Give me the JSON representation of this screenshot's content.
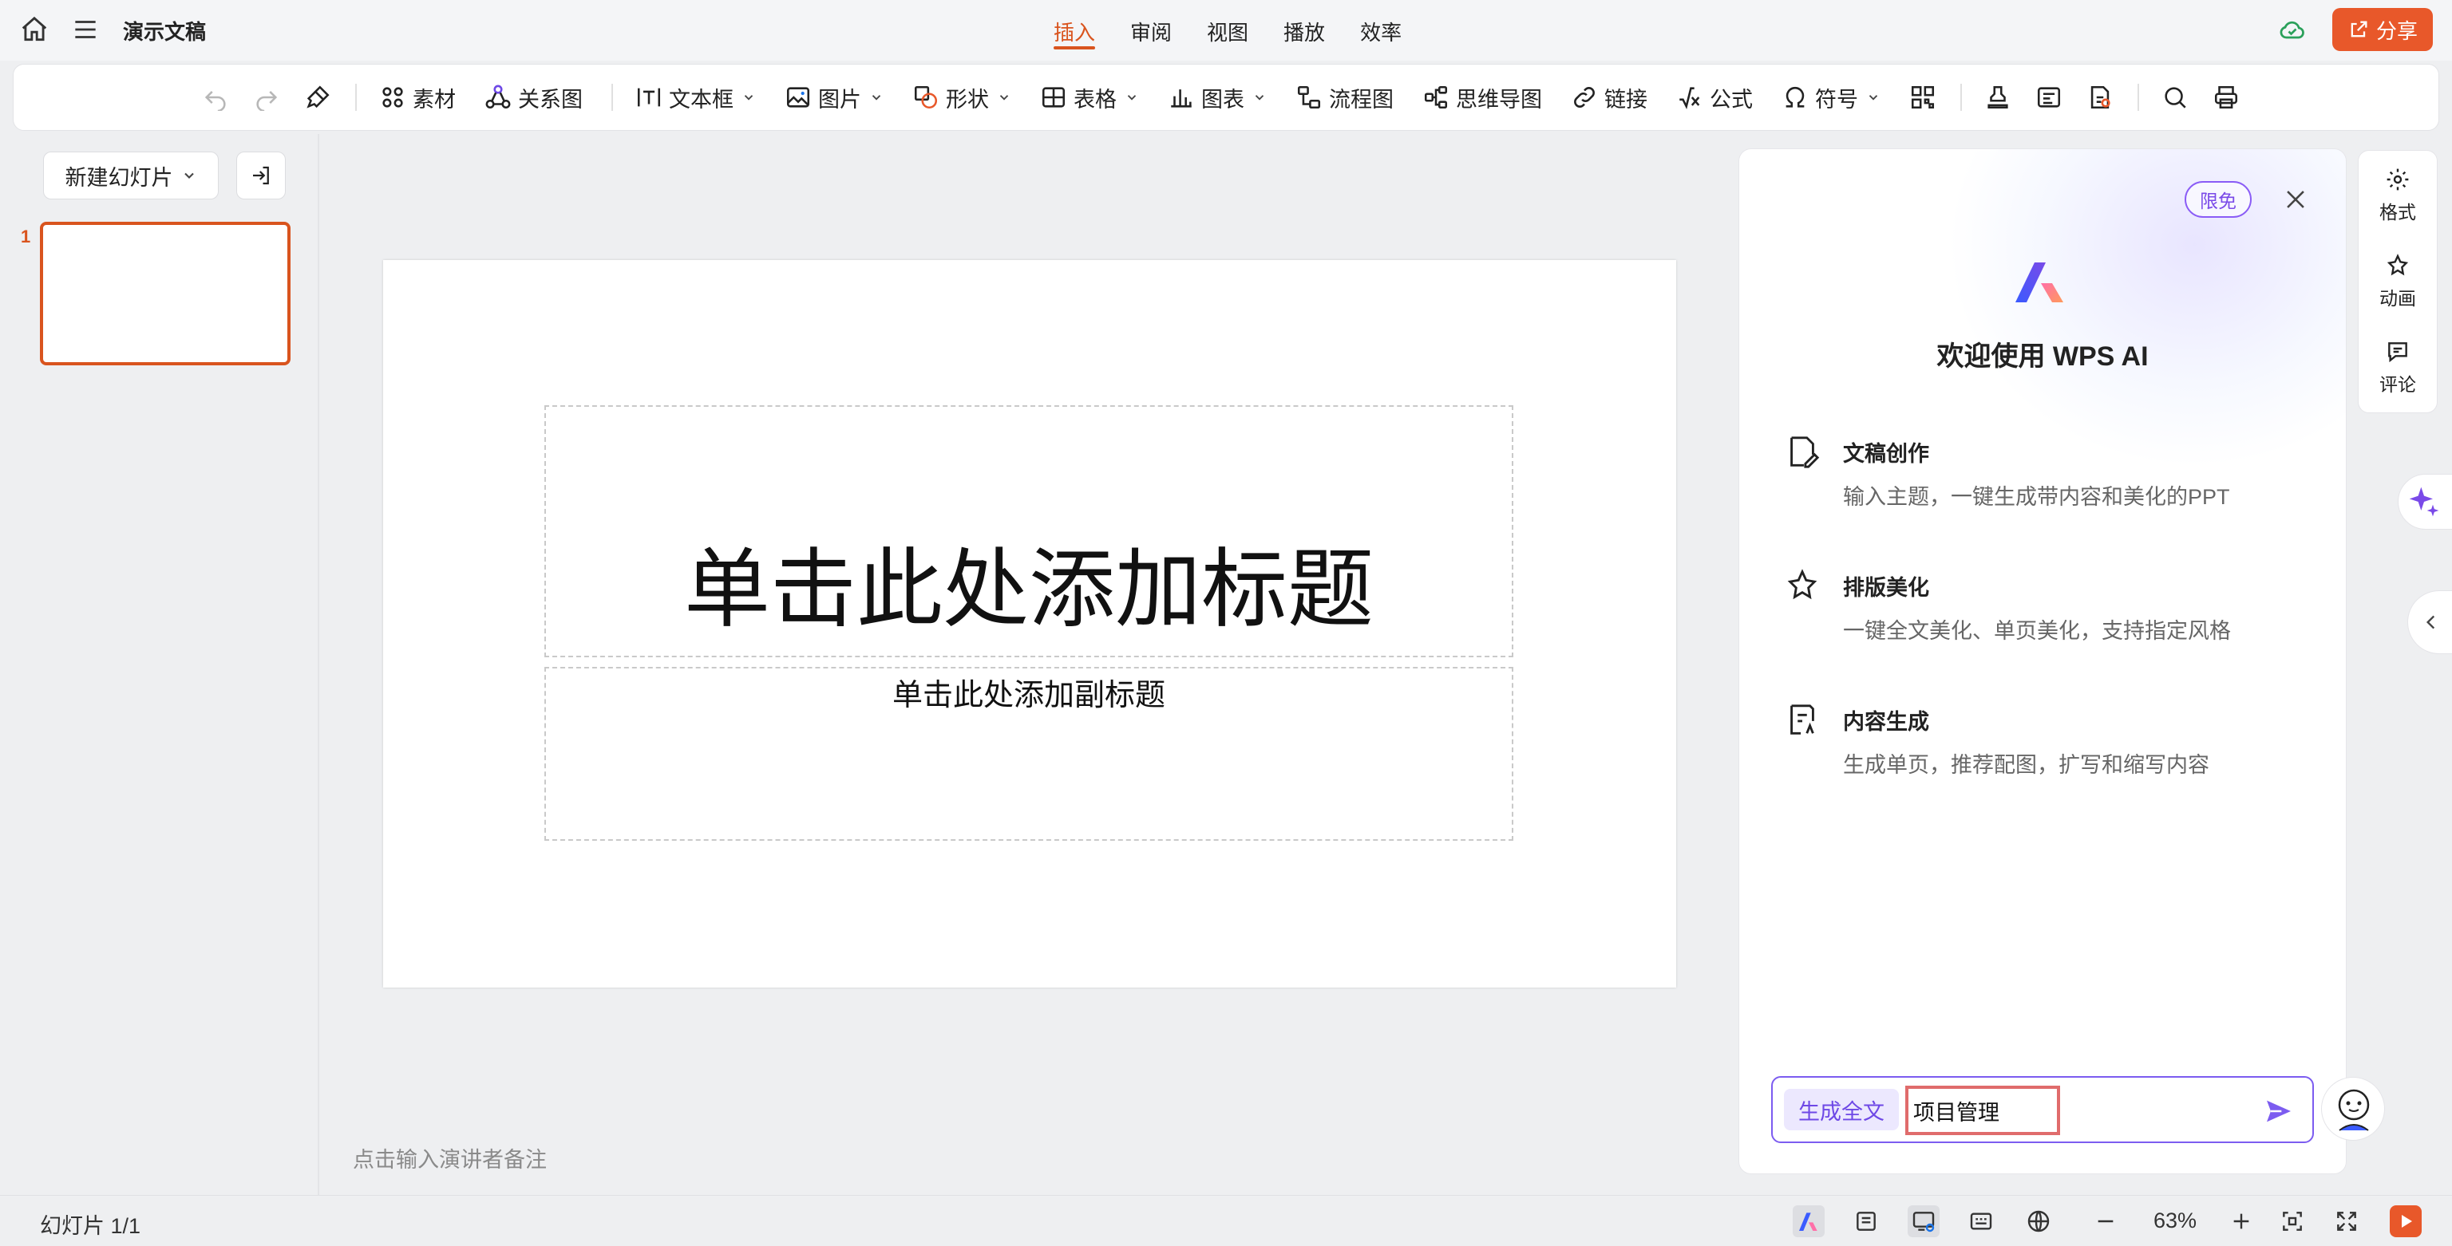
{
  "header": {
    "doc_title": "演示文稿",
    "tabs": [
      {
        "label": "插入",
        "active": true
      },
      {
        "label": "审阅"
      },
      {
        "label": "视图"
      },
      {
        "label": "播放"
      },
      {
        "label": "效率"
      }
    ],
    "share_label": "分享"
  },
  "toolbar": {
    "items": {
      "material": "素材",
      "relation": "关系图",
      "textbox": "文本框",
      "picture": "图片",
      "shape": "形状",
      "table": "表格",
      "chart": "图表",
      "flowchart": "流程图",
      "mindmap": "思维导图",
      "link": "链接",
      "formula": "公式",
      "symbol": "符号"
    }
  },
  "left_panel": {
    "new_slide_label": "新建幻灯片",
    "thumb_number": "1"
  },
  "slide": {
    "title_placeholder": "单击此处添加标题",
    "subtitle_placeholder": "单击此处添加副标题"
  },
  "notes_placeholder": "点击输入演讲者备注",
  "ai_panel": {
    "badge": "限免",
    "welcome": "欢迎使用 WPS AI",
    "features": [
      {
        "title": "文稿创作",
        "desc": "输入主题，一键生成带内容和美化的PPT"
      },
      {
        "title": "排版美化",
        "desc": "一键全文美化、单页美化，支持指定风格"
      },
      {
        "title": "内容生成",
        "desc": "生成单页，推荐配图，扩写和缩写内容"
      }
    ],
    "chip_label": "生成全文",
    "input_value": "项目管理"
  },
  "rail": {
    "format": "格式",
    "animation": "动画",
    "comment": "评论"
  },
  "statusbar": {
    "slide_counter": "幻灯片 1/1",
    "zoom": "63%"
  },
  "colors": {
    "accent": "#d9541e",
    "share": "#e8582a",
    "ai_purple": "#7c5cf0"
  }
}
